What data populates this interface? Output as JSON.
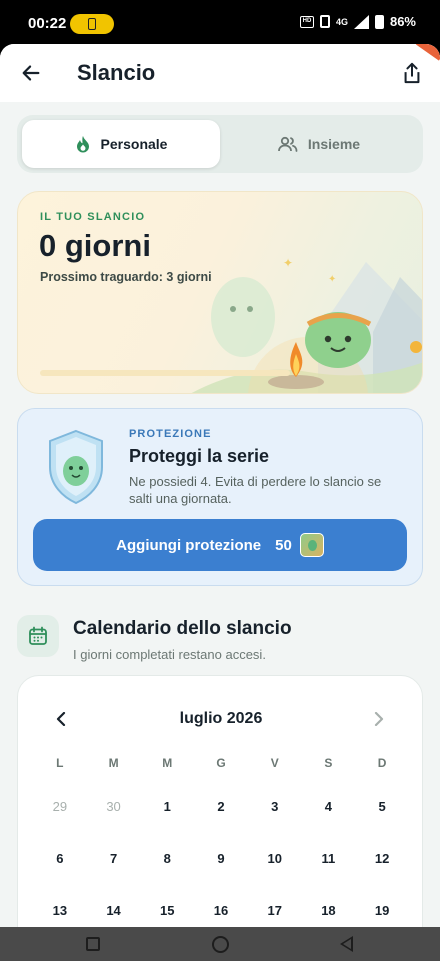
{
  "status_bar": {
    "time": "00:22",
    "battery_percent": "86%",
    "network": "4G",
    "hd_label": "HD"
  },
  "app_bar": {
    "title": "Slancio",
    "back_icon": "arrow-left-icon",
    "share_icon": "share-icon"
  },
  "tabs": [
    {
      "label": "Personale",
      "icon": "flame-icon",
      "active": true
    },
    {
      "label": "Insieme",
      "icon": "people-icon",
      "active": false
    }
  ],
  "streak": {
    "eyebrow": "IL TUO SLANCIO",
    "days": "0 giorni",
    "next_milestone": "Prossimo traguardo: 3 giorni",
    "progress": 0
  },
  "protection": {
    "eyebrow": "PROTEZIONE",
    "title": "Proteggi la serie",
    "description": "Ne possiedi 4. Evita di perdere lo slancio se salti una giornata.",
    "button_label": "Aggiungi protezione",
    "price": "50"
  },
  "calendar_section": {
    "title": "Calendario dello slancio",
    "subtitle": "I giorni completati restano accesi."
  },
  "calendar": {
    "month": "luglio 2026",
    "weekdays": [
      "L",
      "M",
      "M",
      "G",
      "V",
      "S",
      "D"
    ],
    "weeks": [
      [
        {
          "d": "29",
          "muted": true
        },
        {
          "d": "30",
          "muted": true
        },
        {
          "d": "1"
        },
        {
          "d": "2"
        },
        {
          "d": "3"
        },
        {
          "d": "4"
        },
        {
          "d": "5"
        }
      ],
      [
        {
          "d": "6"
        },
        {
          "d": "7"
        },
        {
          "d": "8"
        },
        {
          "d": "9"
        },
        {
          "d": "10"
        },
        {
          "d": "11"
        },
        {
          "d": "12"
        }
      ],
      [
        {
          "d": "13"
        },
        {
          "d": "14"
        },
        {
          "d": "15"
        },
        {
          "d": "16"
        },
        {
          "d": "17"
        },
        {
          "d": "18"
        },
        {
          "d": "19"
        }
      ]
    ]
  },
  "colors": {
    "primary_blue": "#3b7fd0",
    "green_accent": "#2f8f5b",
    "title_text": "#17212b"
  }
}
